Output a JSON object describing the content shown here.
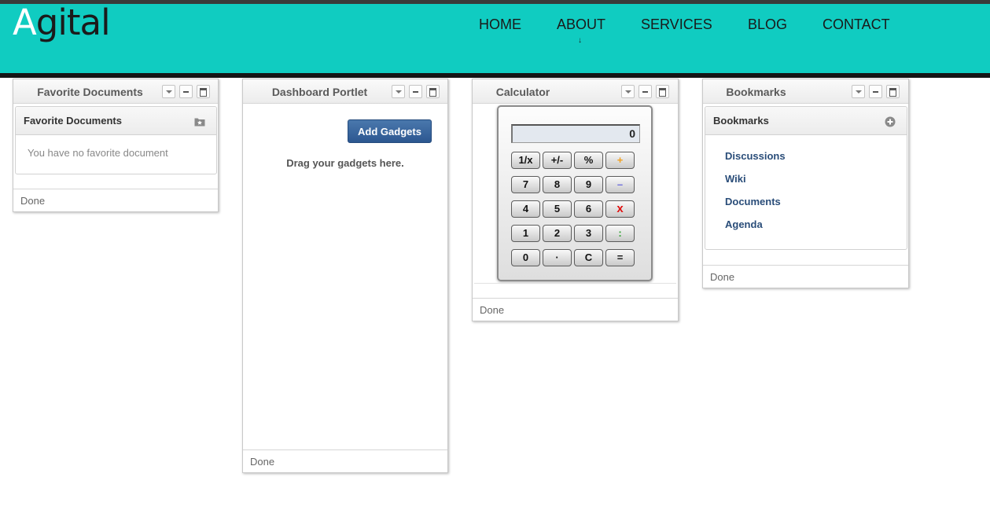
{
  "logo": {
    "part1": "A",
    "part2": "gital"
  },
  "nav": {
    "items": [
      "HOME",
      "ABOUT",
      "SERVICES",
      "BLOG",
      "CONTACT"
    ],
    "about_caret": "↓"
  },
  "portlets": {
    "favorites": {
      "title": "Favorite Documents",
      "inner_title": "Favorite Documents",
      "empty_text": "You have no favorite document",
      "status": "Done"
    },
    "dashboard": {
      "title": "Dashboard Portlet",
      "add_button": "Add Gadgets",
      "drag_text": "Drag your gadgets here.",
      "status": "Done"
    },
    "calculator": {
      "title": "Calculator",
      "display": "0",
      "keys": [
        [
          "1/x",
          "+/-",
          "%",
          "+"
        ],
        [
          "7",
          "8",
          "9",
          "–"
        ],
        [
          "4",
          "5",
          "6",
          "x"
        ],
        [
          "1",
          "2",
          "3",
          ":"
        ],
        [
          "0",
          "·",
          "C",
          "="
        ]
      ],
      "op_colors": {
        "+": "#f0a020",
        "–": "#6a6adc",
        "x": "#e01010",
        ":": "#2aa02a"
      },
      "status": "Done"
    },
    "bookmarks": {
      "title": "Bookmarks",
      "inner_title": "Bookmarks",
      "links": [
        "Discussions",
        "Wiki",
        "Documents",
        "Agenda"
      ],
      "status": "Done"
    }
  },
  "colors": {
    "header": "#10ccc1",
    "link": "#2a4d79",
    "button": "#2c5790"
  }
}
